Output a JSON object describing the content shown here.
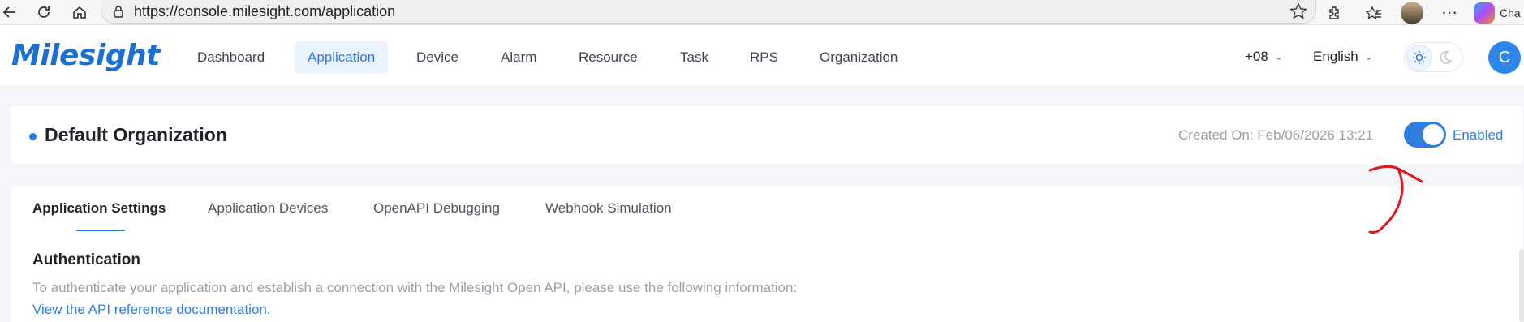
{
  "browser": {
    "url": "https://console.milesight.com/application",
    "profile_label": "Cha"
  },
  "header": {
    "logo": "Milesight",
    "menu": [
      {
        "label": "Dashboard",
        "active": false
      },
      {
        "label": "Application",
        "active": true
      },
      {
        "label": "Device",
        "active": false
      },
      {
        "label": "Alarm",
        "active": false
      },
      {
        "label": "Resource",
        "active": false
      },
      {
        "label": "Task",
        "active": false
      },
      {
        "label": "RPS",
        "active": false
      },
      {
        "label": "Organization",
        "active": false
      }
    ],
    "timezone": "+08",
    "language": "English",
    "theme": "light",
    "avatar_initial": "C"
  },
  "org": {
    "name": "Default Organization",
    "created_on": "Created On: Feb/06/2026 13:21",
    "status_label": "Enabled",
    "enabled": true
  },
  "tabs": [
    {
      "label": "Application Settings",
      "active": true
    },
    {
      "label": "Application Devices",
      "active": false
    },
    {
      "label": "OpenAPI Debugging",
      "active": false
    },
    {
      "label": "Webhook Simulation",
      "active": false
    }
  ],
  "auth": {
    "title": "Authentication",
    "description": "To authenticate your application and establish a connection with the Milesight Open API, please use the following information:",
    "link": "View the API reference documentation."
  },
  "colors": {
    "accent": "#2e7de0",
    "annotation": "#e01818"
  }
}
